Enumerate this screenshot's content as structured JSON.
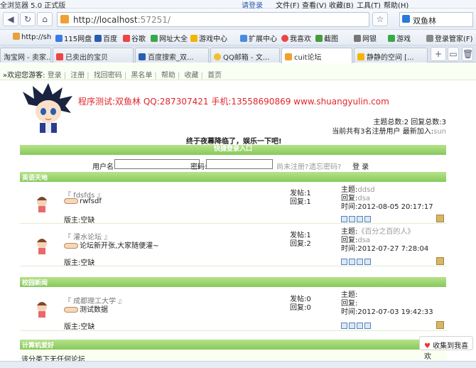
{
  "browser": {
    "title": "全浏览器 5.0 正式版",
    "user_link": "请登录",
    "menus": [
      "文件(F)",
      "查看(V)",
      "收藏(B)",
      "工具(T)",
      "帮助(H)"
    ],
    "url": "http://localhost",
    "url_port": ":57251/",
    "search_text": "双鱼林",
    "bookmarks": [
      "http://sh",
      "115网盘",
      "百度",
      "谷歌",
      "网址大全",
      "游戏中心",
      "扩展中心",
      "我喜欢",
      "截图",
      "网银",
      "游戏",
      "登录管家(F)"
    ],
    "tabs": [
      "淘宝网 - 卖家...",
      "已卖出的宝贝",
      "百度搜索_双...",
      "QQ邮箱 - 文...",
      "cuit论坛",
      "静静的空间 [..."
    ],
    "colors": {
      "accent": "#86c95a",
      "link": "#e1262c"
    }
  },
  "page": {
    "greeting": "»欢迎您游客:",
    "nav": [
      "登录",
      "注册",
      "找回密码",
      "黑名单",
      "帮助",
      "收藏",
      "首页"
    ],
    "promo": "程序测试:双鱼林 QQ:287307421 手机:13558690869 www.shuangyulin.com",
    "stats_line1": "主题总数:2 回复总数:3",
    "stats_line2": "当前共有3名注册用户 最新加入:",
    "newest_user": "sun",
    "motto": "终于夜幕降临了，娱乐一下吧!",
    "login": {
      "title": "快捷登录入口",
      "user_label": "用户名:",
      "pwd_label": "密码:",
      "register": "尚未注册?",
      "forgot": "遗忘密码?",
      "submit": "登 录"
    },
    "sections": [
      {
        "title": "英语天地",
        "forums": [
          {
            "name": "『 fdsfds 』",
            "desc": "rwfsdf",
            "moderator": "版主:空缺",
            "posts": "发帖:1",
            "replies": "回复:1",
            "topic_label": "主题:",
            "topic": "ddsd",
            "reply_label": "回复:",
            "reply_user": "dsa",
            "time": "时间:2012-08-05 20:17:17"
          },
          {
            "name": "『 灌水论坛 』",
            "desc": "论坛新开张,大家随便灌~",
            "moderator": "版主:空缺",
            "posts": "发帖:1",
            "replies": "回复:2",
            "topic_label": "主题:",
            "topic": "《百分之百的人》",
            "reply_label": "回复:",
            "reply_user": "dsa",
            "time": "时间:2012-07-27 7:28:04"
          }
        ]
      },
      {
        "title": "校园新闻",
        "forums": [
          {
            "name": "『 成都理工大学 』",
            "desc": "测试数据",
            "moderator": "版主:空缺",
            "posts": "发帖:0",
            "replies": "回复:0",
            "topic_label": "主题:",
            "topic": "",
            "reply_label": "回复:",
            "reply_user": "",
            "time": "时间:2012-07-03 19:42:33"
          }
        ]
      },
      {
        "title": "计算机爱好",
        "empty": "该分类下无任何论坛"
      }
    ],
    "collect": "收集到我喜欢"
  }
}
